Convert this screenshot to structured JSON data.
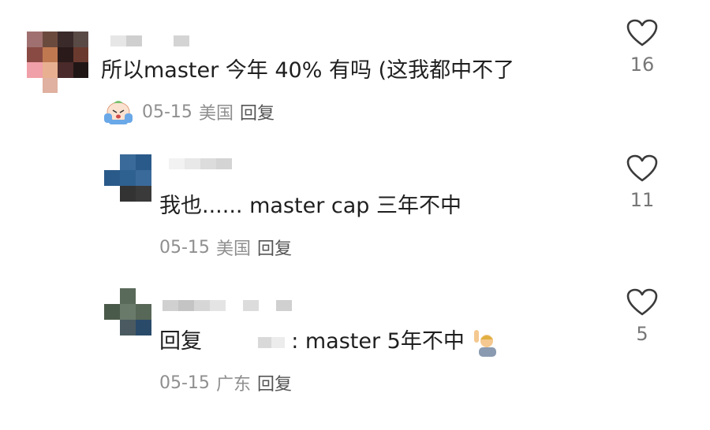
{
  "comments": [
    {
      "text": "所以master 今年 40% 有吗 (这我都中不了",
      "date": "05-15",
      "location": "美国",
      "reply_label": "回复",
      "likes": "16",
      "badge_icon": "crying-face-sticker-icon"
    },
    {
      "text": "我也...... master cap 三年不中",
      "date": "05-15",
      "location": "美国",
      "reply_label": "回复",
      "likes": "11"
    },
    {
      "text_prefix": "回复",
      "text_suffix": ": master 5年不中",
      "trailing_emoji": "person-raising-hand-emoji-icon",
      "date": "05-15",
      "location": "广东",
      "reply_label": "回复",
      "likes": "5"
    }
  ],
  "colors": {
    "text": "#1f1f1f",
    "meta": "#8f8f8f",
    "heart_stroke": "#3a3a3a"
  }
}
